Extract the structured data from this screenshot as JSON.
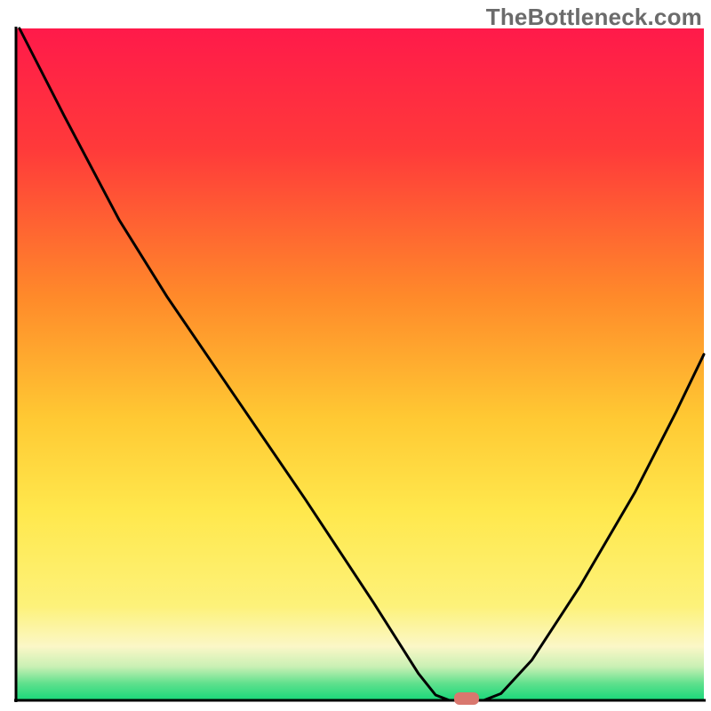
{
  "watermark": "TheBottleneck.com",
  "chart_data": {
    "type": "line",
    "title": "",
    "xlabel": "",
    "ylabel": "",
    "xlim": [
      0,
      100
    ],
    "ylim": [
      0,
      100
    ],
    "grid": false,
    "legend": false,
    "background_gradient": {
      "stops": [
        {
          "offset": 0.0,
          "color": "#ff1a4a"
        },
        {
          "offset": 0.18,
          "color": "#ff3a3a"
        },
        {
          "offset": 0.4,
          "color": "#ff8a2a"
        },
        {
          "offset": 0.58,
          "color": "#ffc933"
        },
        {
          "offset": 0.72,
          "color": "#ffe84d"
        },
        {
          "offset": 0.86,
          "color": "#fdf27a"
        },
        {
          "offset": 0.92,
          "color": "#fbf7c7"
        },
        {
          "offset": 0.95,
          "color": "#c9f0b4"
        },
        {
          "offset": 0.975,
          "color": "#5fe08d"
        },
        {
          "offset": 1.0,
          "color": "#18d87a"
        }
      ]
    },
    "series": [
      {
        "name": "bottleneck-curve",
        "comment": "x is relative position across plot (0..100). y is bottleneck percent (0 flat bottom, 100 top of plot). Values estimated from pixel positions.",
        "points": [
          {
            "x": 0.5,
            "y": 100.0
          },
          {
            "x": 7.0,
            "y": 87.0
          },
          {
            "x": 15.0,
            "y": 71.5
          },
          {
            "x": 22.0,
            "y": 60.0
          },
          {
            "x": 32.0,
            "y": 45.0
          },
          {
            "x": 42.0,
            "y": 30.0
          },
          {
            "x": 52.0,
            "y": 14.5
          },
          {
            "x": 58.5,
            "y": 4.0
          },
          {
            "x": 61.0,
            "y": 0.8
          },
          {
            "x": 63.0,
            "y": 0.0
          },
          {
            "x": 68.0,
            "y": 0.0
          },
          {
            "x": 70.5,
            "y": 1.0
          },
          {
            "x": 75.0,
            "y": 6.0
          },
          {
            "x": 82.0,
            "y": 17.0
          },
          {
            "x": 90.0,
            "y": 31.0
          },
          {
            "x": 96.0,
            "y": 43.0
          },
          {
            "x": 100.0,
            "y": 51.5
          }
        ]
      }
    ],
    "marker": {
      "name": "optimal-point",
      "x": 65.5,
      "y": 0.0,
      "color": "#d9776e",
      "shape": "rounded-rect"
    },
    "axes": {
      "color": "#000000",
      "width": 3
    }
  }
}
